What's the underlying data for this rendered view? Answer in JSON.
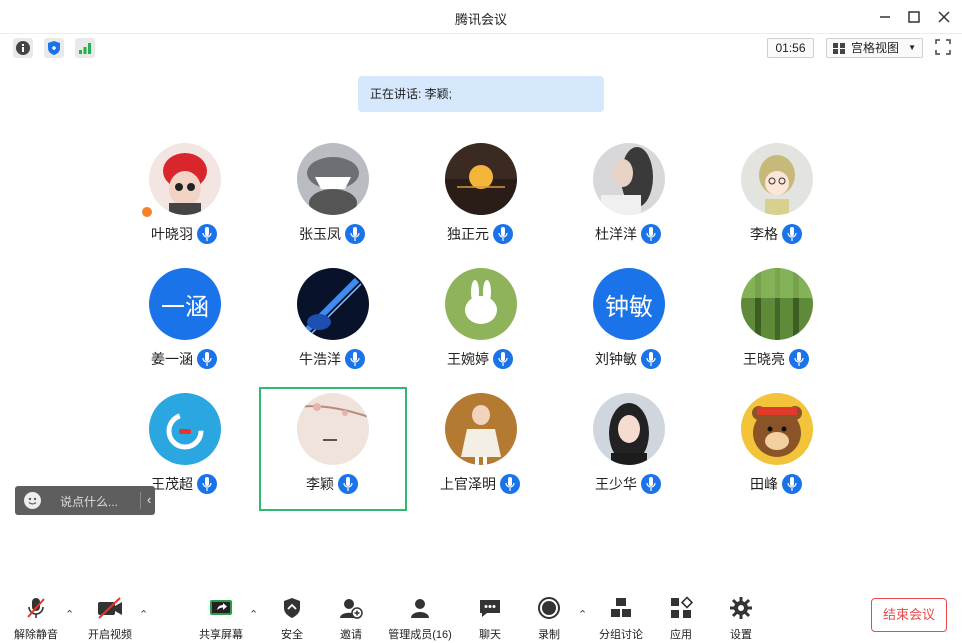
{
  "window": {
    "title": "腾讯会议"
  },
  "toolbar": {
    "timer": "01:56",
    "view_label": "宫格视图"
  },
  "speaking": {
    "text": "正在讲话: 李颖;"
  },
  "participants": [
    {
      "name": "叶晓羽"
    },
    {
      "name": "张玉凤"
    },
    {
      "name": "独正元"
    },
    {
      "name": "杜洋洋"
    },
    {
      "name": "李格"
    },
    {
      "name": "姜一涵",
      "avatar_text": "一涵"
    },
    {
      "name": "牛浩洋"
    },
    {
      "name": "王婉婷"
    },
    {
      "name": "刘钟敏",
      "avatar_text": "钟敏"
    },
    {
      "name": "王晓亮"
    },
    {
      "name": "王茂超"
    },
    {
      "name": "李颖"
    },
    {
      "name": "上官泽明"
    },
    {
      "name": "王少华"
    },
    {
      "name": "田峰"
    }
  ],
  "chat": {
    "placeholder": "说点什么..."
  },
  "bottom": {
    "unmute": "解除静音",
    "video": "开启视频",
    "share": "共享屏幕",
    "security": "安全",
    "invite": "邀请",
    "members": "管理成员(16)",
    "chat": "聊天",
    "record": "录制",
    "breakout": "分组讨论",
    "apps": "应用",
    "settings": "设置",
    "end": "结束会议"
  },
  "colors": {
    "accent": "#1a73e8",
    "end": "#e64a4a",
    "selected_border": "#2eb872",
    "speaking_bg": "#d6e8fc"
  }
}
